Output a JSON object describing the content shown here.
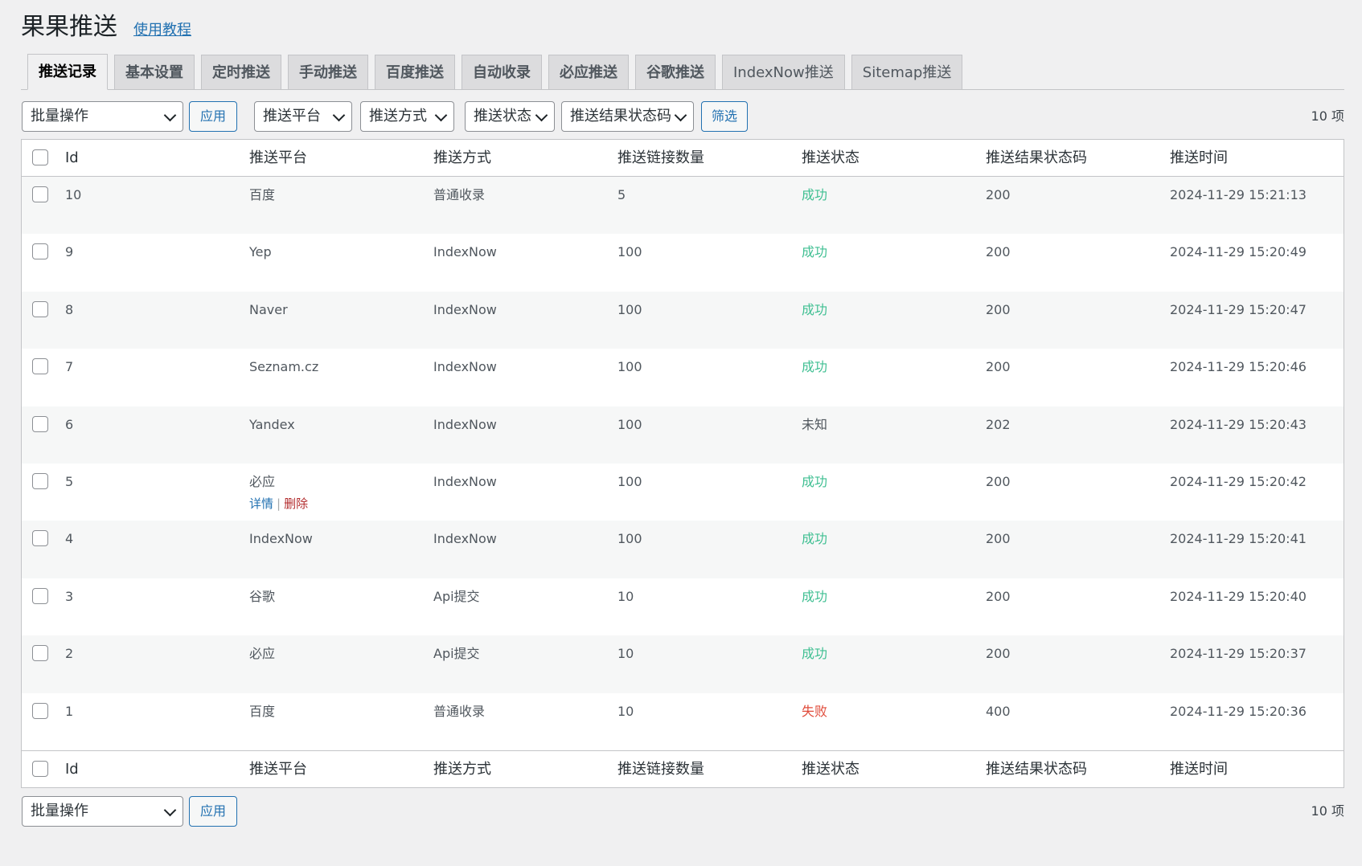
{
  "header": {
    "title": "果果推送",
    "tutorial_link": "使用教程"
  },
  "tabs": [
    {
      "label": "推送记录"
    },
    {
      "label": "基本设置"
    },
    {
      "label": "定时推送"
    },
    {
      "label": "手动推送"
    },
    {
      "label": "百度推送"
    },
    {
      "label": "自动收录"
    },
    {
      "label": "必应推送"
    },
    {
      "label": "谷歌推送"
    },
    {
      "label": "IndexNow推送"
    },
    {
      "label": "Sitemap推送"
    }
  ],
  "toolbar": {
    "bulk_action": "批量操作",
    "apply_label": "应用",
    "filter_platform": "推送平台",
    "filter_method": "推送方式",
    "filter_status": "推送状态",
    "filter_code": "推送结果状态码",
    "filter_button": "筛选",
    "item_count": "10 项"
  },
  "table": {
    "columns": [
      "Id",
      "推送平台",
      "推送方式",
      "推送链接数量",
      "推送状态",
      "推送结果状态码",
      "推送时间"
    ],
    "row_actions": {
      "detail": "详情",
      "separator": "|",
      "delete": "删除"
    },
    "rows": [
      {
        "id": "10",
        "platform": "百度",
        "method": "普通收录",
        "count": "5",
        "status": "成功",
        "status_type": "success",
        "code": "200",
        "time": "2024-11-29 15:21:13"
      },
      {
        "id": "9",
        "platform": "Yep",
        "method": "IndexNow",
        "count": "100",
        "status": "成功",
        "status_type": "success",
        "code": "200",
        "time": "2024-11-29 15:20:49"
      },
      {
        "id": "8",
        "platform": "Naver",
        "method": "IndexNow",
        "count": "100",
        "status": "成功",
        "status_type": "success",
        "code": "200",
        "time": "2024-11-29 15:20:47"
      },
      {
        "id": "7",
        "platform": "Seznam.cz",
        "method": "IndexNow",
        "count": "100",
        "status": "成功",
        "status_type": "success",
        "code": "200",
        "time": "2024-11-29 15:20:46"
      },
      {
        "id": "6",
        "platform": "Yandex",
        "method": "IndexNow",
        "count": "100",
        "status": "未知",
        "status_type": "unknown",
        "code": "202",
        "time": "2024-11-29 15:20:43"
      },
      {
        "id": "5",
        "platform": "必应",
        "method": "IndexNow",
        "count": "100",
        "status": "成功",
        "status_type": "success",
        "code": "200",
        "time": "2024-11-29 15:20:42"
      },
      {
        "id": "4",
        "platform": "IndexNow",
        "method": "IndexNow",
        "count": "100",
        "status": "成功",
        "status_type": "success",
        "code": "200",
        "time": "2024-11-29 15:20:41"
      },
      {
        "id": "3",
        "platform": "谷歌",
        "method": "Api提交",
        "count": "10",
        "status": "成功",
        "status_type": "success",
        "code": "200",
        "time": "2024-11-29 15:20:40"
      },
      {
        "id": "2",
        "platform": "必应",
        "method": "Api提交",
        "count": "10",
        "status": "成功",
        "status_type": "success",
        "code": "200",
        "time": "2024-11-29 15:20:37"
      },
      {
        "id": "1",
        "platform": "百度",
        "method": "普通收录",
        "count": "10",
        "status": "失败",
        "status_type": "fail",
        "code": "400",
        "time": "2024-11-29 15:20:36"
      }
    ]
  },
  "colors": {
    "success": "#3fbf92",
    "fail": "#e04b3a",
    "link": "#2271b1",
    "delete": "#b32d2e"
  }
}
